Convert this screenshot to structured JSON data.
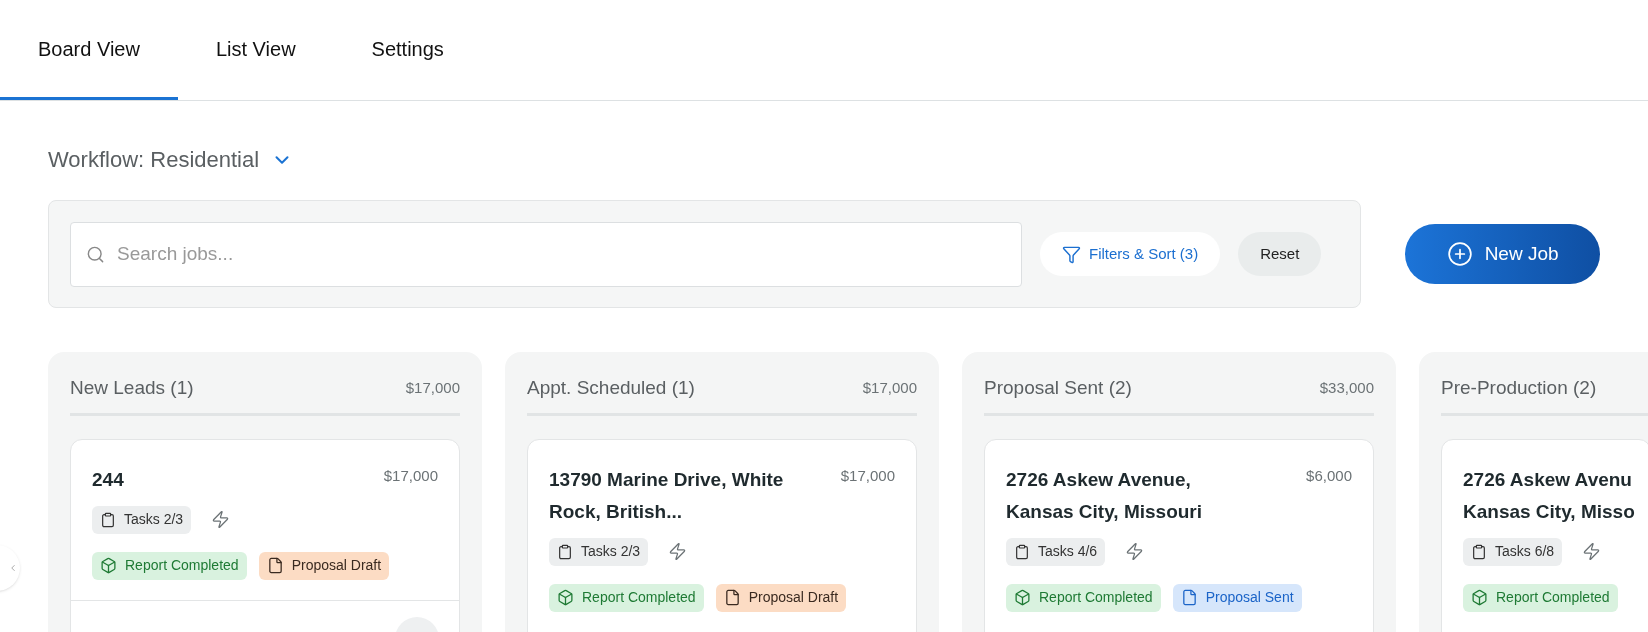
{
  "tabs": [
    {
      "label": "Board View",
      "selected": true
    },
    {
      "label": "List View",
      "selected": false
    },
    {
      "label": "Settings",
      "selected": false
    }
  ],
  "workflow": {
    "label": "Workflow: Residential"
  },
  "toolbar": {
    "search": {
      "placeholder": "Search jobs..."
    },
    "filters_button": "Filters & Sort (3)",
    "reset_button": "Reset",
    "new_job_button": "New Job"
  },
  "columns": [
    {
      "title": "New Leads (1)",
      "total": "$17,000",
      "cards": [
        {
          "title": "244",
          "price": "$17,000",
          "tasks": "Tasks 2/3",
          "tags": [
            {
              "kind": "report",
              "label": "Report Completed"
            },
            {
              "kind": "draft",
              "label": "Proposal Draft"
            }
          ]
        }
      ]
    },
    {
      "title": "Appt. Scheduled (1)",
      "total": "$17,000",
      "cards": [
        {
          "title": "13790 Marine Drive, White\nRock, British...",
          "price": "$17,000",
          "tasks": "Tasks 2/3",
          "tags": [
            {
              "kind": "report",
              "label": "Report Completed"
            },
            {
              "kind": "draft",
              "label": "Proposal Draft"
            }
          ]
        }
      ]
    },
    {
      "title": "Proposal Sent (2)",
      "total": "$33,000",
      "cards": [
        {
          "title": "2726 Askew Avenue,\nKansas City, Missouri",
          "price": "$6,000",
          "tasks": "Tasks 4/6",
          "tags": [
            {
              "kind": "report",
              "label": "Report Completed"
            },
            {
              "kind": "sent",
              "label": "Proposal Sent"
            }
          ]
        }
      ]
    },
    {
      "title": "Pre-Production (2)",
      "cards": [
        {
          "title": "2726 Askew Avenu\nKansas City, Misso",
          "tasks": "Tasks 6/8",
          "tags": [
            {
              "kind": "report",
              "label": "Report Completed"
            }
          ]
        }
      ]
    }
  ]
}
